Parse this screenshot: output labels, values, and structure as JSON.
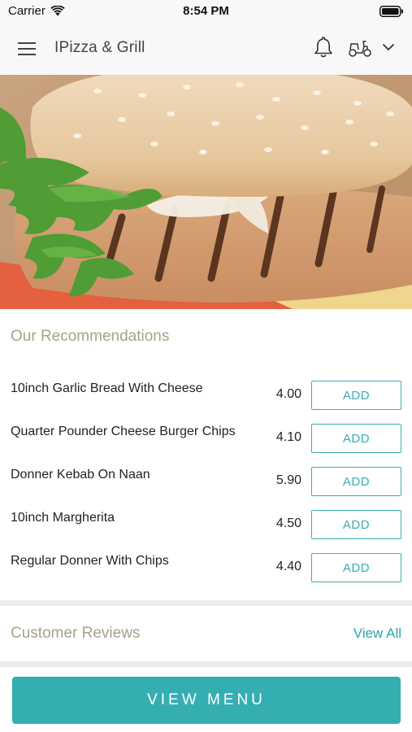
{
  "status_bar": {
    "carrier": "Carrier",
    "time": "8:54 PM"
  },
  "header": {
    "title": "IPizza & Grill"
  },
  "hero": {
    "icon": "burger-photo"
  },
  "recommendations": {
    "title": "Our Recommendations",
    "items": [
      {
        "name": "10inch Garlic Bread With Cheese",
        "price": "4.00",
        "button": "ADD"
      },
      {
        "name": "Quarter Pounder Cheese Burger Chips",
        "price": "4.10",
        "button": "ADD"
      },
      {
        "name": "Donner Kebab On Naan",
        "price": "5.90",
        "button": "ADD"
      },
      {
        "name": "10inch Margherita",
        "price": "4.50",
        "button": "ADD"
      },
      {
        "name": "Regular Donner With Chips",
        "price": "4.40",
        "button": "ADD"
      }
    ]
  },
  "reviews": {
    "title": "Customer Reviews",
    "link": "View All"
  },
  "footer": {
    "button": "VIEW MENU"
  },
  "colors": {
    "accent": "#35aeb2",
    "section_title": "#a8a18a",
    "link": "#2ea4a6"
  }
}
